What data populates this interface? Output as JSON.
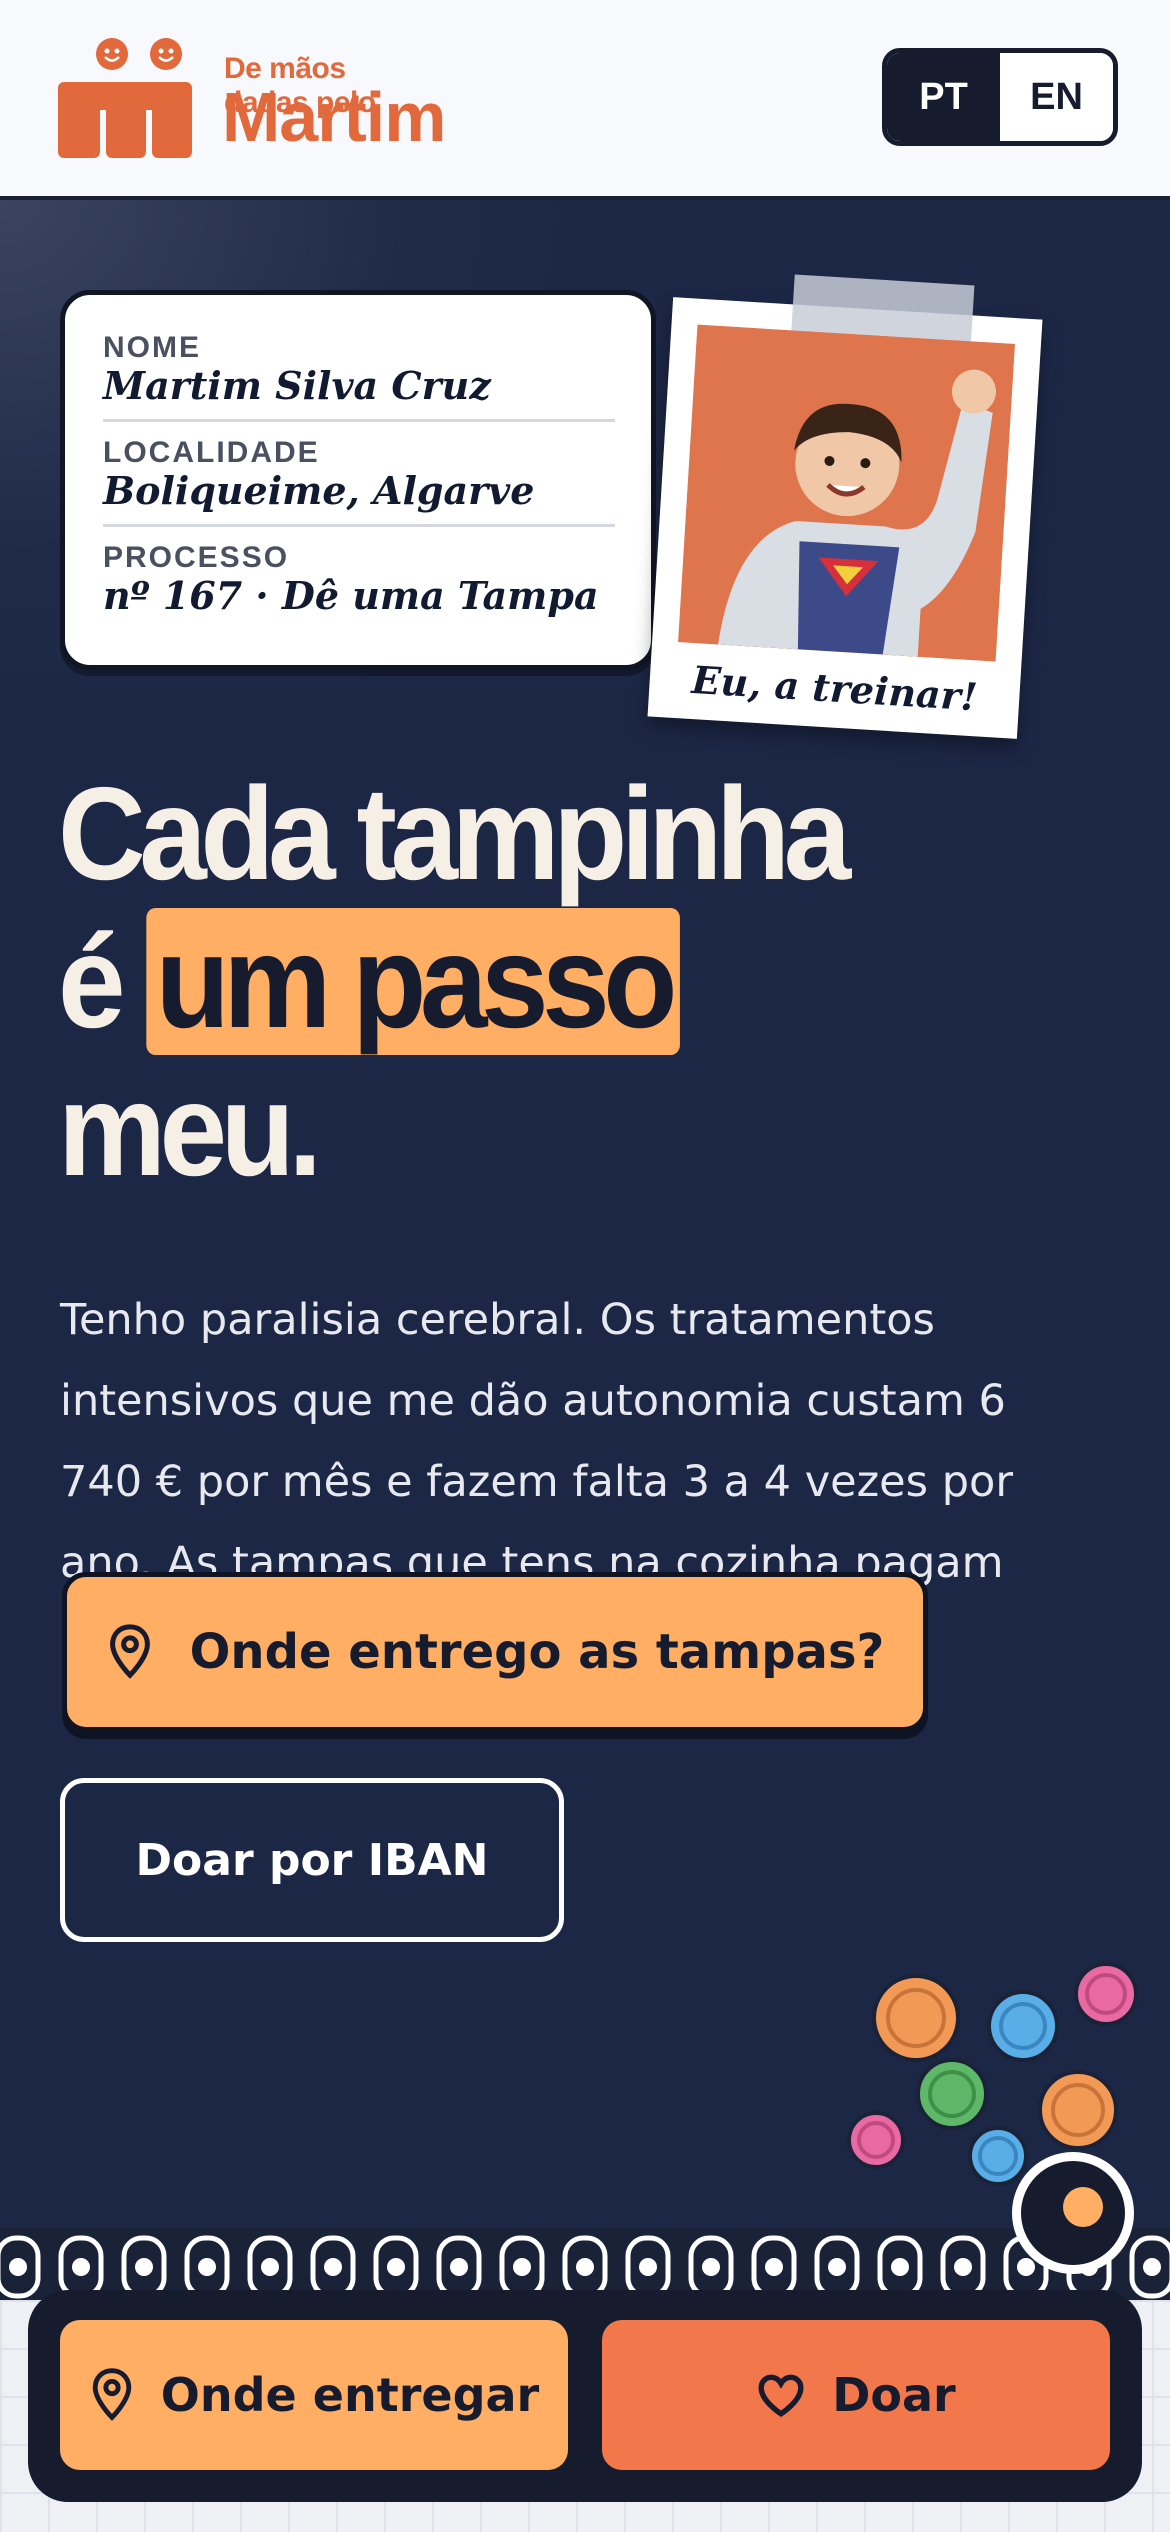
{
  "header": {
    "logo_line1": "De mãos dadas pelo",
    "logo_line2": "Martim",
    "lang_pt": "PT",
    "lang_en": "EN"
  },
  "card": {
    "fields": [
      {
        "label": "NOME",
        "value": "Martim Silva Cruz"
      },
      {
        "label": "LOCALIDADE",
        "value": "Boliqueime, Algarve"
      },
      {
        "label": "PROCESSO",
        "value": "nº 167 · Dê uma Tampa"
      }
    ]
  },
  "polaroid": {
    "caption": "Eu, a treinar!"
  },
  "headline": {
    "line1": "Cada tampinha",
    "line2_pre": "é",
    "line2_highlight": "um passo",
    "line3": "meu."
  },
  "paragraph": "Tenho paralisia cerebral. Os tratamentos intensivos que me dão autonomia custam 6 740 € por mês e fazem falta 3 a 4 vezes por ano. As tampas que tens na cozinha pagam parte deles.",
  "buttons": {
    "primary": "Onde entrego as tampas?",
    "secondary": "Doar por IBAN"
  },
  "bottom_bar": {
    "left": "Onde entregar",
    "right": "Doar"
  },
  "colors": {
    "navy": "#1c2746",
    "orange": "#ffae63",
    "coral": "#f2774a",
    "brand": "#e1693c"
  },
  "icons": [
    "location-pin-icon",
    "heart-icon",
    "bottle-cap-icon"
  ]
}
